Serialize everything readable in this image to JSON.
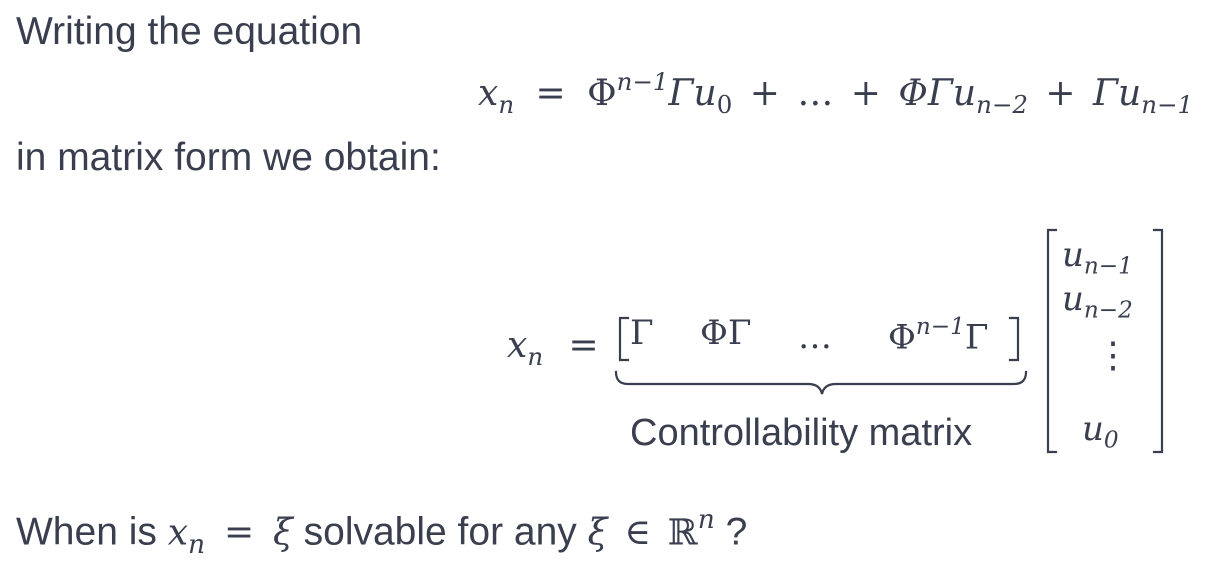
{
  "slide": {
    "intro_text": "Writing the equation",
    "equation1": {
      "lhs": "x",
      "lhs_sub": "n",
      "eq": "=",
      "term1_base": "Φ",
      "term1_sup": "n−1",
      "term1_rest": "Γu",
      "term1_sub": "0",
      "plus1": "+",
      "dots": "…",
      "plus2": "+",
      "term2": "ΦΓu",
      "term2_sub": "n−2",
      "plus3": "+",
      "term3": "Γu",
      "term3_sub": "n−1"
    },
    "matrix_form_text": "in matrix form we obtain:",
    "equation2": {
      "lhs": "x",
      "lhs_sub": "n",
      "eq": "=",
      "row_entries": [
        "Γ",
        "ΦΓ",
        "…",
        "Φ"
      ],
      "last_sup": "n−1",
      "last_tail": "Γ",
      "brace_label": "Controllability matrix",
      "vector": [
        {
          "base": "u",
          "sub": "n−1"
        },
        {
          "base": "u",
          "sub": "n−2"
        },
        {
          "base": "⋮",
          "sub": ""
        },
        {
          "base": "u",
          "sub": "0"
        }
      ]
    },
    "question": {
      "prefix": "When is ",
      "lhs": "x",
      "lhs_sub": "n",
      "eq": "=",
      "xi": "ξ",
      "middle": " solvable for any ",
      "xi2": "ξ",
      "in": "∈",
      "R": "ℝ",
      "R_sup": "n",
      "suffix": " ?"
    }
  }
}
